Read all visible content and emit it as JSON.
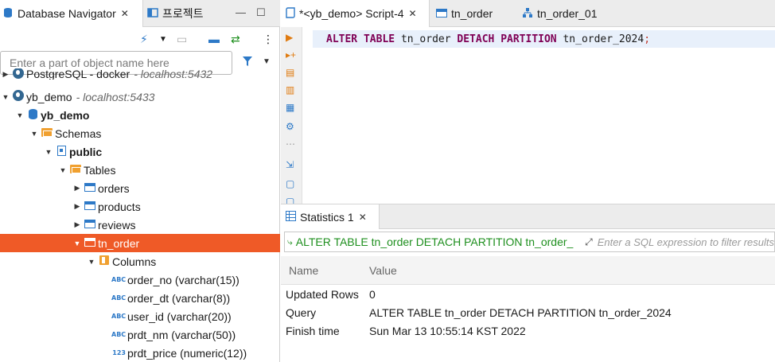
{
  "left_panel": {
    "tabs": [
      {
        "label": "Database Navigator",
        "icon": "database-navigator-icon"
      },
      {
        "label": "프로젝트",
        "icon": "project-icon"
      }
    ],
    "filter": {
      "placeholder": "Enter a part of object name here"
    },
    "tree": [
      {
        "label": "PostgreSQL - docker",
        "host": "- localhost:5432",
        "icon": "postgres-icon"
      },
      {
        "label": "yb_demo",
        "host": "- localhost:5433",
        "icon": "postgres-icon"
      },
      {
        "label": "yb_demo",
        "icon": "database-icon"
      },
      {
        "label": "Schemas",
        "icon": "folder-icon"
      },
      {
        "label": "public",
        "icon": "schema-icon"
      },
      {
        "label": "Tables",
        "icon": "folder-icon"
      },
      {
        "label": "orders",
        "icon": "table-icon"
      },
      {
        "label": "products",
        "icon": "table-icon"
      },
      {
        "label": "reviews",
        "icon": "table-icon"
      },
      {
        "label": "tn_order",
        "icon": "table-icon"
      },
      {
        "label": "Columns",
        "icon": "columns-icon"
      },
      {
        "label": "order_no (varchar(15))",
        "type": "ABC"
      },
      {
        "label": "order_dt (varchar(8))",
        "type": "ABC"
      },
      {
        "label": "user_id (varchar(20))",
        "type": "ABC"
      },
      {
        "label": "prdt_nm (varchar(50))",
        "type": "ABC"
      },
      {
        "label": "prdt_price (numeric(12))",
        "type": "123"
      }
    ]
  },
  "editor": {
    "tabs": [
      {
        "label": "*<yb_demo> Script-4"
      },
      {
        "label": "tn_order"
      },
      {
        "label": "tn_order_01"
      }
    ],
    "code": {
      "kw1": "ALTER",
      "kw2": "TABLE",
      "t1": "tn_order",
      "kw3": "DETACH",
      "kw4": "PARTITION",
      "t2": "tn_order_2024",
      "semi": ";"
    }
  },
  "results": {
    "tab_label": "Statistics 1",
    "query_text": "ALTER TABLE tn_order DETACH PARTITION tn_order_",
    "filter_placeholder": "Enter a SQL expression to filter results",
    "columns": {
      "name": "Name",
      "value": "Value"
    },
    "rows": [
      {
        "name": "Updated Rows",
        "value": "0"
      },
      {
        "name": "Query",
        "value": "ALTER TABLE tn_order DETACH PARTITION tn_order_2024"
      },
      {
        "name": "Finish time",
        "value": "Sun Mar 13 10:55:14 KST 2022"
      }
    ]
  },
  "colors": {
    "selection": "#ef5a27",
    "keyword": "#7f0055",
    "query_green": "#1e8f1e"
  }
}
